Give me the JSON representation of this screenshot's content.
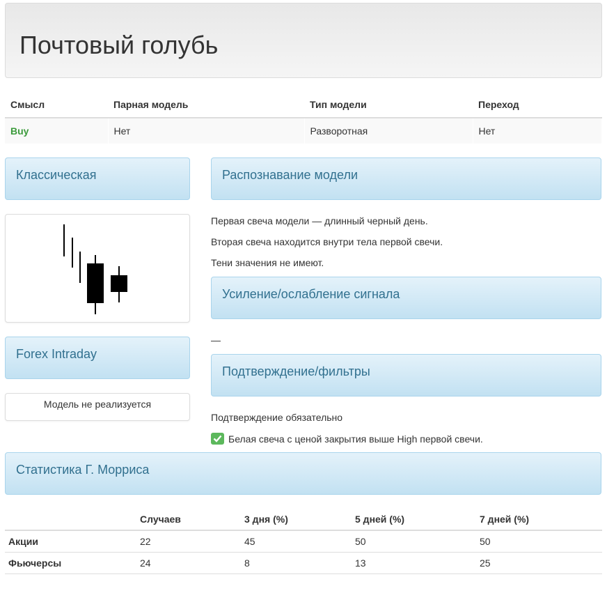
{
  "page": {
    "title": "Почтовый голубь"
  },
  "info_table": {
    "headers": [
      "Смысл",
      "Парная модель",
      "Тип модели",
      "Переход"
    ],
    "row": {
      "meaning": "Buy",
      "paired": "Нет",
      "type": "Разворотная",
      "transition": "Нет"
    }
  },
  "panels": {
    "classic": "Классическая",
    "recognition": "Распознавание модели",
    "strength": "Усиление/ослабление сигнала",
    "confirmation": "Подтверждение/фильтры",
    "forex": "Forex Intraday",
    "stats": "Статистика Г. Морриса"
  },
  "recognition_lines": [
    "Первая свеча модели — длинный черный день.",
    "Вторая свеча находится внутри тела первой свечи.",
    "Тени значения не имеют."
  ],
  "strength_text": "—",
  "forex_text": "Модель не реализуется",
  "confirmation": {
    "required": "Подтверждение обязательно",
    "filter": "Белая свеча с ценой закрытия выше High первой свечи."
  },
  "stats_table": {
    "headers": [
      "",
      "Случаев",
      "3 дня (%)",
      "5 дней (%)",
      "7 дней (%)"
    ],
    "rows": [
      {
        "label": "Акции",
        "cases": "22",
        "d3": "45",
        "d5": "50",
        "d7": "50"
      },
      {
        "label": "Фьючерсы",
        "cases": "24",
        "d3": "8",
        "d5": "13",
        "d7": "25"
      }
    ]
  },
  "colors": {
    "buy": "#3c9b3c",
    "panel_text": "#31708f",
    "check": "#5cb85c"
  },
  "icons": {
    "check": "check-icon"
  }
}
